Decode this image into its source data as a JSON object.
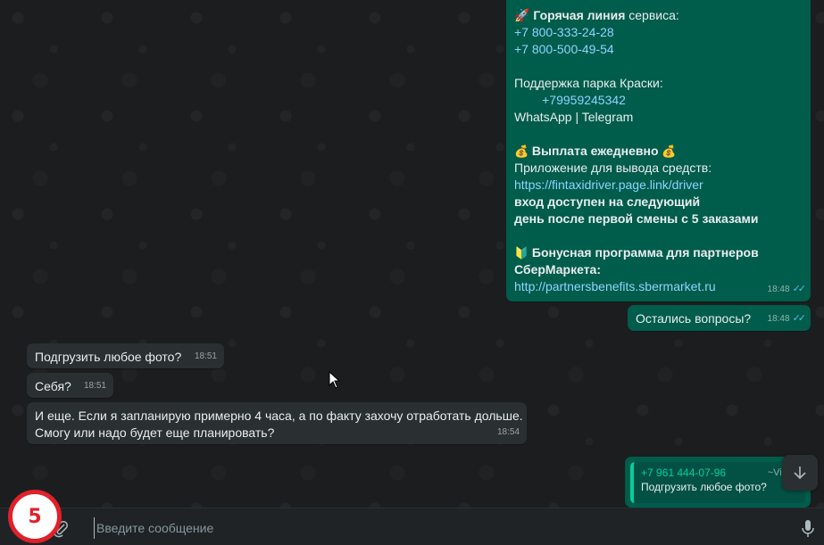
{
  "chat": {
    "big_message": {
      "hotline_prefix": "🚀 ",
      "hotline_bold": "Горячая линия",
      "hotline_rest": " сервиса:",
      "phone1": "+7 800-333-24-28",
      "phone2": "+7 800-500-49-54",
      "park_support": "Поддержка парка Краски:",
      "park_phone": "        +79959245342",
      "messengers": "WhatsApp | Telegram",
      "payout_emoji_left": "💰",
      "payout_title": "Выплата ежедневно",
      "payout_emoji_right": "💰",
      "app_line": "Приложение для вывода средств:",
      "app_link": "https://fintaxidriver.page.link/driver",
      "access_line1": "вход доступен на следующий",
      "access_line2": "день после первой смены с 5 заказами",
      "bonus_emoji": "🔰",
      "bonus_line1": "Бонусная программа для партнеров",
      "bonus_line2": "СберМаркета:",
      "bonus_link": "http://partnersbenefits.sbermarket.ru",
      "time": "18:48"
    },
    "questions_message": {
      "text": "Остались вопросы?",
      "time": "18:48"
    },
    "incoming": [
      {
        "text": "Подгрузить любое фото?",
        "time": "18:51"
      },
      {
        "text": "Себя?",
        "time": "18:51"
      },
      {
        "line1": "И еще. Если я запланирую примерно 4 часа, а по факту захочу отработать дольше.",
        "line2": "Смогу или надо будет еще планировать?",
        "time": "18:54"
      }
    ],
    "reply_message": {
      "quoted_number": "+7 961 444-07-96",
      "quoted_name": "~Viktor",
      "quoted_text": "Подгрузить любое фото?"
    }
  },
  "composer": {
    "placeholder": "Введите сообщение"
  },
  "step_badge": "5",
  "icons": {
    "attach": "paperclip-icon",
    "mic": "microphone-icon",
    "scroll": "arrow-down-icon",
    "ticks": "double-check-icon"
  },
  "colors": {
    "outgoing_bubble": "#005c4b",
    "incoming_bubble": "#2a2f32",
    "read_ticks": "#53bdeb",
    "badge_red": "#e0202a"
  }
}
